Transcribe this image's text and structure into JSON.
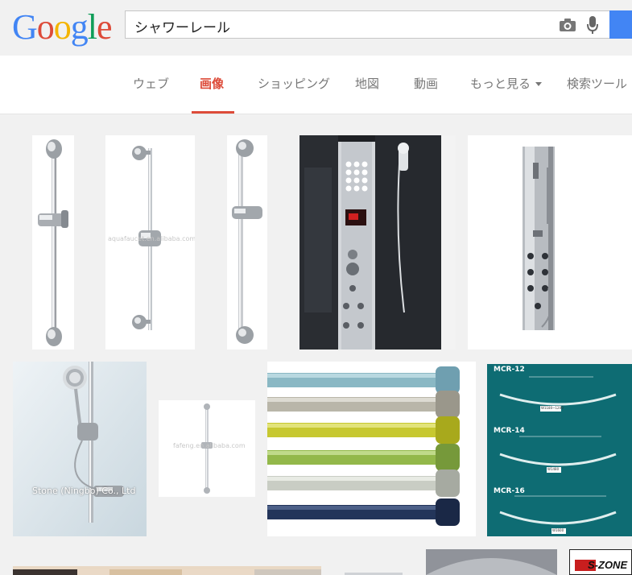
{
  "logo": {
    "text": "Google",
    "letters": [
      "G",
      "o",
      "o",
      "g",
      "l",
      "e"
    ],
    "colors": [
      "#4285f4",
      "#dd4b39",
      "#f4b400",
      "#4285f4",
      "#0f9d58",
      "#dd4b39"
    ]
  },
  "search": {
    "query": "シャワーレール",
    "camera_icon": "camera-icon",
    "mic_icon": "microphone-icon"
  },
  "tabs": [
    {
      "label": "ウェブ"
    },
    {
      "label": "画像",
      "active": true
    },
    {
      "label": "ショッピング"
    },
    {
      "label": "地図"
    },
    {
      "label": "動画"
    },
    {
      "label": "もっと見る"
    },
    {
      "label": "検索ツール"
    }
  ],
  "results": [
    {
      "watermark": "aquafaucet.en.alibaba.com"
    },
    {
      "watermark": "Stone (Ningbo) Co., Ltd"
    },
    {
      "watermark": "fafeng.en.alibaba.com"
    },
    {
      "labels": [
        "MCR-12",
        "MCR-14",
        "MCR-16"
      ],
      "sizes": [
        "W1180~1200",
        "W1480",
        "W1600"
      ]
    },
    {
      "text": "S-ZONE"
    }
  ],
  "colors": {
    "accent": "#dd4b39",
    "search_button": "#4285f4"
  }
}
